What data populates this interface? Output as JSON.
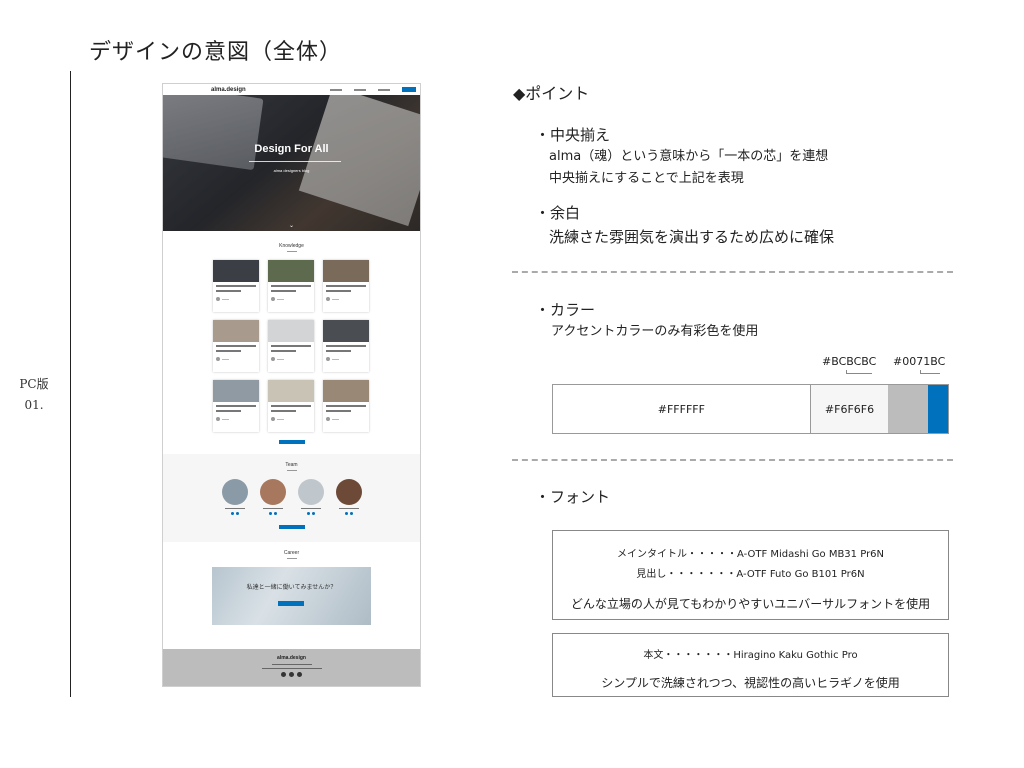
{
  "page": {
    "title": "デザインの意図（全体）",
    "side_label_1": "PC版",
    "side_label_2": "01."
  },
  "mockup": {
    "logo": "alma.design",
    "hero_title": "Design For All",
    "hero_subtitle": "alma designers blog",
    "knowledge_title": "Knowledge",
    "team_title": "Team",
    "career_title": "Career",
    "career_banner_text": "私達と一緒に働いてみませんか？",
    "footer_logo": "alma.design"
  },
  "notes": {
    "point_heading": "◆ポイント",
    "center": {
      "heading": "・中央揃え",
      "line1": "alma（魂）という意味から「一本の芯」を連想",
      "line2": "中央揃えにすることで上記を表現"
    },
    "whitespace": {
      "heading": "・余白",
      "line1": "洗練さた雰囲気を演出するため広めに確保"
    },
    "color": {
      "heading": "・カラー",
      "line1": "アクセントカラーのみ有彩色を使用"
    },
    "font": {
      "heading": "・フォント"
    }
  },
  "palette": {
    "white": "#FFFFFF",
    "light_gray": "#F6F6F6",
    "gray": "#BCBCBC",
    "accent": "#0071BC"
  },
  "font_box_1": {
    "main_title": "メインタイトル・・・・・A-OTF Midashi Go MB31 Pr6N",
    "heading": "見出し・・・・・・・A-OTF Futo Go B101 Pr6N",
    "desc": "どんな立場の人が見てもわかりやすいユニバーサルフォントを使用"
  },
  "font_box_2": {
    "body": "本文・・・・・・・Hiragino Kaku Gothic Pro",
    "desc": "シンプルで洗練されつつ、視認性の高いヒラギノを使用"
  }
}
